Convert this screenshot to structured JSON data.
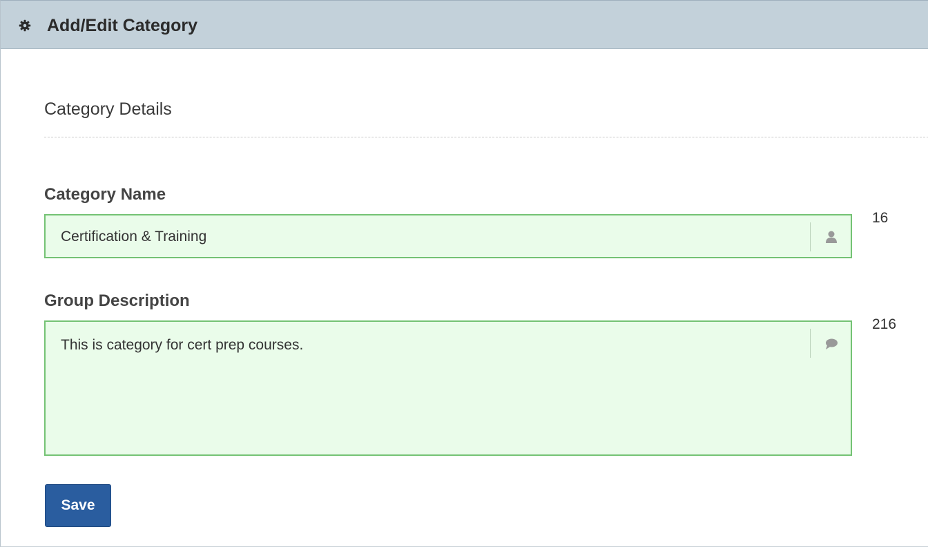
{
  "header": {
    "title": "Add/Edit Category",
    "icon": "gear-icon"
  },
  "section": {
    "title": "Category Details"
  },
  "fields": {
    "category_name": {
      "label": "Category Name",
      "value": "Certification & Training",
      "icon": "user-icon",
      "counter": "16"
    },
    "group_description": {
      "label": "Group Description",
      "value": "This is category for cert prep courses.",
      "icon": "comment-icon",
      "counter": "216"
    }
  },
  "actions": {
    "save_label": "Save"
  },
  "colors": {
    "header_bg": "#c3d1da",
    "input_bg": "#eafcea",
    "input_border": "#74c274",
    "primary_button": "#2a5d9f"
  }
}
